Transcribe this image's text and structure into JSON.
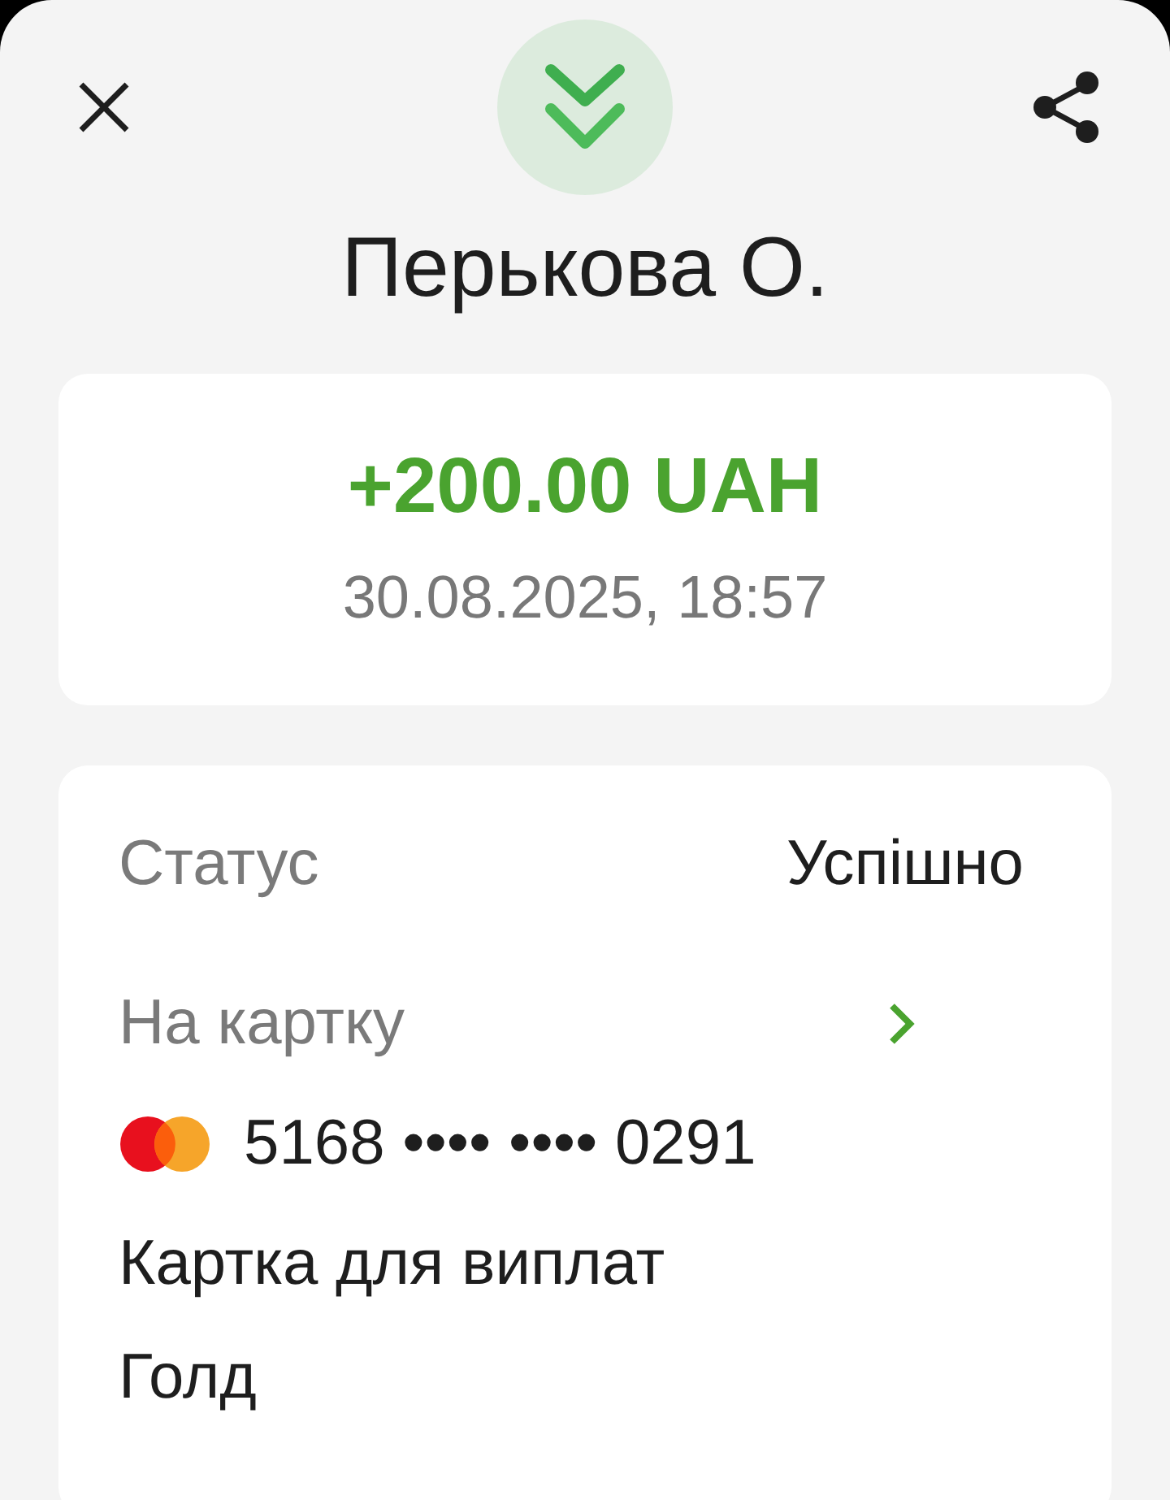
{
  "header": {
    "name": "Перькова О."
  },
  "summary": {
    "amount": "+200.00 UAH",
    "datetime": "30.08.2025, 18:57"
  },
  "details": {
    "status_label": "Статус",
    "status_value": "Успішно",
    "card_label": "На картку",
    "card_number": "5168 •••• •••• 0291",
    "card_name": "Картка для виплат",
    "card_tier": "Голд"
  }
}
